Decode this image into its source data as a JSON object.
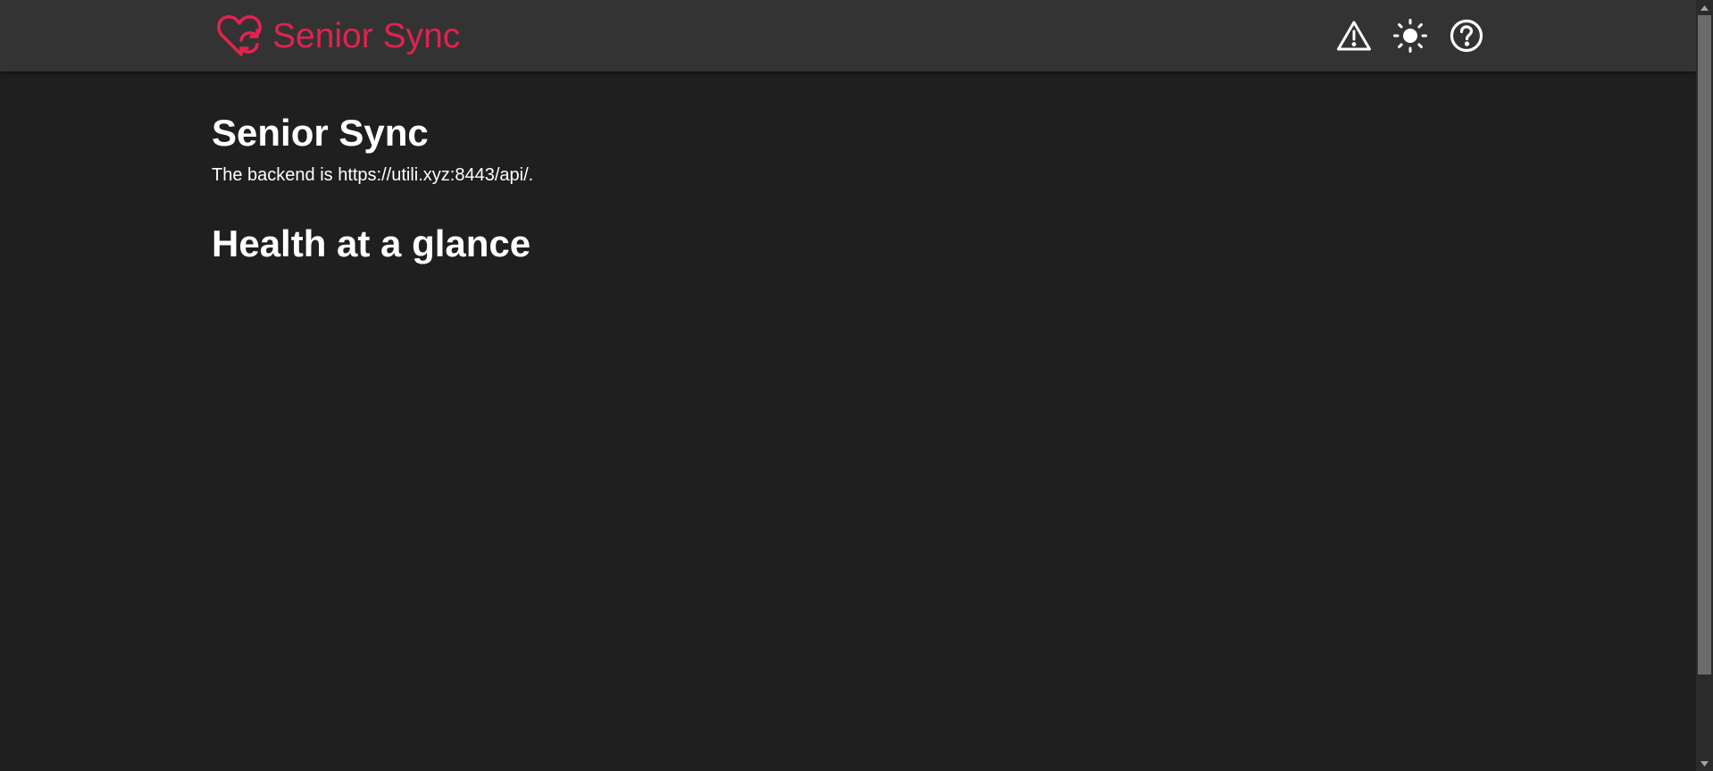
{
  "navbar": {
    "brand_name": "Senior Sync",
    "logo_icon": "heart-sync-icon",
    "icons": [
      "warning-icon",
      "sun-icon",
      "help-icon"
    ]
  },
  "main": {
    "title": "Senior Sync",
    "backend_text": "The backend is https://utili.xyz:8443/api/.",
    "section_title": "Health at a glance"
  },
  "colors": {
    "brand": "#e0234e",
    "navbar_bg": "#333333",
    "page_bg": "#1f1f1f",
    "text": "#ffffff"
  }
}
